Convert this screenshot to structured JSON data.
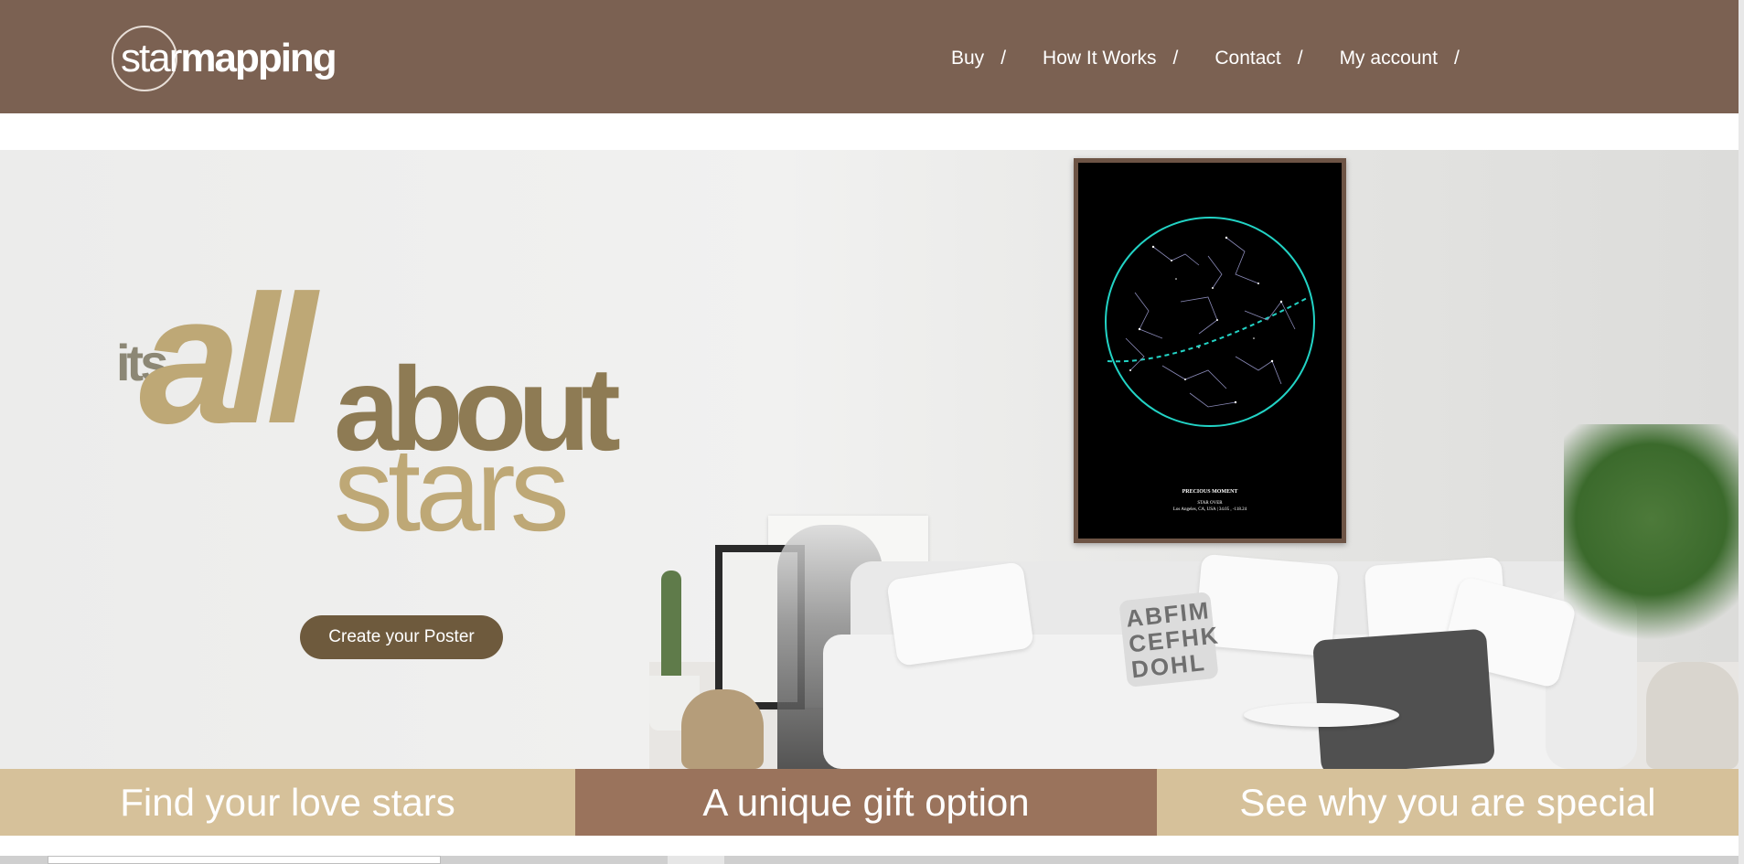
{
  "header": {
    "logo": {
      "light": "star",
      "bold": "mapping"
    },
    "nav": [
      {
        "label": "Buy",
        "sep": "/"
      },
      {
        "label": "How It Works",
        "sep": "/"
      },
      {
        "label": "Contact",
        "sep": "/"
      },
      {
        "label": "My account",
        "sep": "/"
      }
    ]
  },
  "hero": {
    "headline": {
      "its": "its",
      "all": "all",
      "about": "about",
      "stars": "stars"
    },
    "cta_label": "Create your Poster",
    "poster": {
      "line1": "PRECIOUS MOMENT",
      "line2": "STAR OVER",
      "line3": "Los Angeles, CA, USA | 34.05 , -118.24"
    },
    "pillow_text": "ABFIM CEFHK DOHL"
  },
  "feature_bars": [
    {
      "label": "Find your love stars"
    },
    {
      "label": "A unique gift option"
    },
    {
      "label": "See why you are special"
    }
  ],
  "colors": {
    "header_bg": "#7b6152",
    "cta_bg": "#6e5a3d",
    "bar_light": "#d6c19a",
    "bar_dark": "#9a735c",
    "gold": "#bea876"
  }
}
